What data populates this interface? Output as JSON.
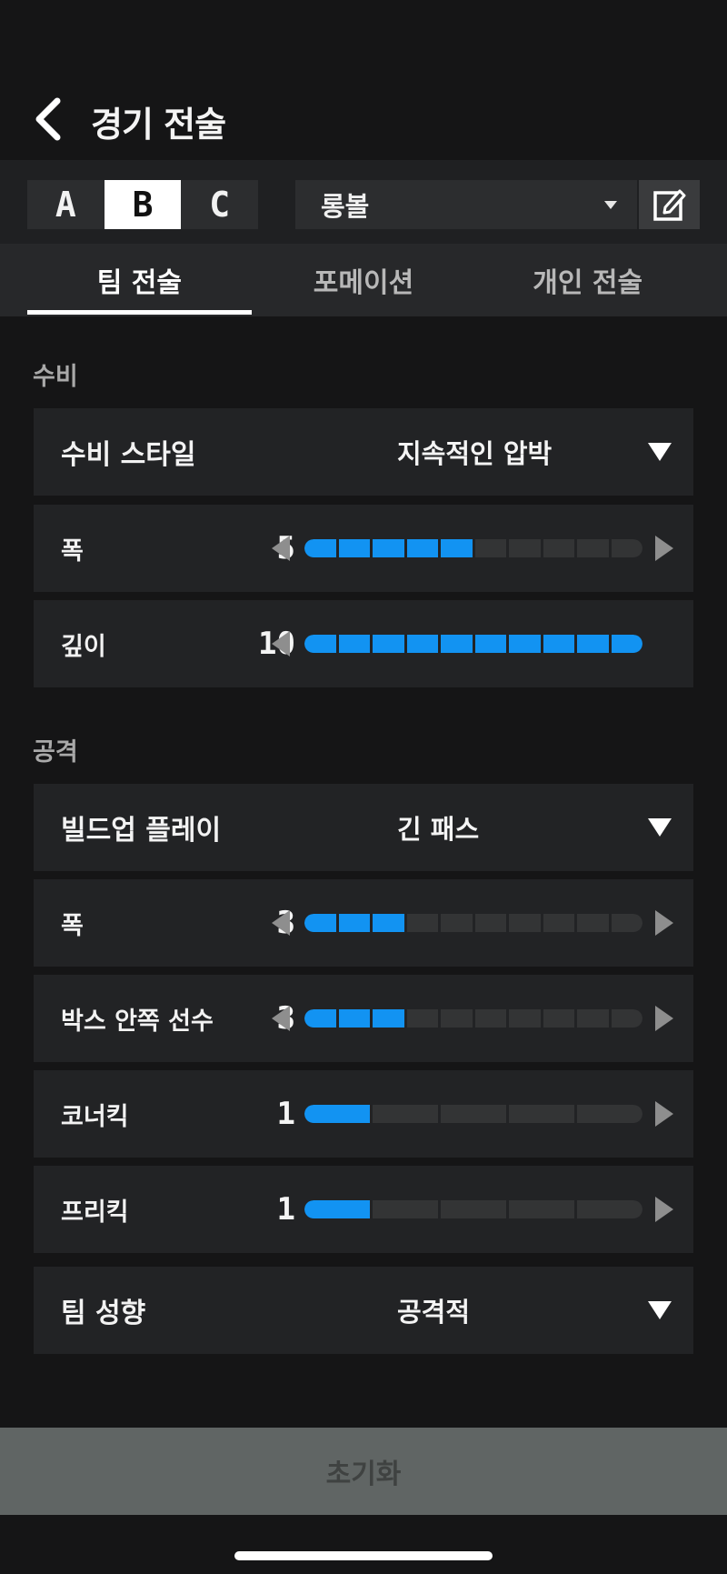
{
  "header": {
    "title": "경기 전술"
  },
  "presets": {
    "slots": [
      "A",
      "B",
      "C"
    ],
    "active_slot": "B",
    "selected_preset": "롱볼"
  },
  "tabs": [
    {
      "label": "팀 전술",
      "active": true
    },
    {
      "label": "포메이션",
      "active": false
    },
    {
      "label": "개인 전술",
      "active": false
    }
  ],
  "defense": {
    "section_label": "수비",
    "style": {
      "label": "수비 스타일",
      "value": "지속적인 압박"
    },
    "width": {
      "label": "폭",
      "value": 5,
      "max": 10
    },
    "depth": {
      "label": "깊이",
      "value": 10,
      "max": 10
    }
  },
  "attack": {
    "section_label": "공격",
    "buildup": {
      "label": "빌드업 플레이",
      "value": "긴 패스"
    },
    "width": {
      "label": "폭",
      "value": 3,
      "max": 10
    },
    "box_players": {
      "label": "박스 안쪽 선수",
      "value": 3,
      "max": 10
    },
    "corner_kick": {
      "label": "코너킥",
      "value": 1,
      "max": 5
    },
    "free_kick": {
      "label": "프리킥",
      "value": 1,
      "max": 5
    }
  },
  "team_mentality": {
    "label": "팀 성향",
    "value": "공격적"
  },
  "footer": {
    "reset_label": "초기화"
  },
  "colors": {
    "accent": "#1293f2",
    "bar_empty": "#333435",
    "panel": "#222325",
    "background": "#151516"
  }
}
